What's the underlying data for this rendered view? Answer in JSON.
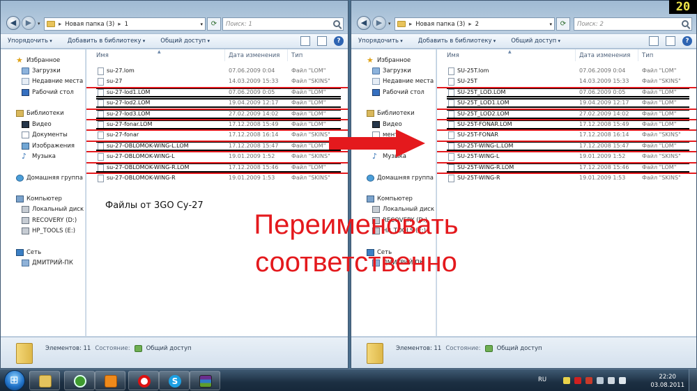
{
  "windows": [
    {
      "id": "left",
      "breadcrumb": [
        "Новая папка (3)",
        "1"
      ],
      "search_placeholder": "Поиск: 1",
      "toolbar": {
        "organize": "Упорядочить",
        "add_library": "Добавить в библиотеку",
        "share": "Общий доступ"
      },
      "columns": {
        "name": "Имя",
        "date": "Дата изменения",
        "type": "Тип"
      },
      "files": [
        {
          "name": "su-27.lom",
          "date": "07.06.2009 0:04",
          "type": "Файл \"LOM\""
        },
        {
          "name": "su-27",
          "date": "14.03.2009 15:33",
          "type": "Файл \"SKINS\""
        },
        {
          "name": "su-27-lod1.LOM",
          "date": "07.06.2009 0:05",
          "type": "Файл \"LOM\""
        },
        {
          "name": "su-27-lod2.LOM",
          "date": "19.04.2009 12:17",
          "type": "Файл \"LOM\""
        },
        {
          "name": "su-27-lod3.LOM",
          "date": "27.02.2009 14:02",
          "type": "Файл \"LOM\""
        },
        {
          "name": "su-27-fonar.LOM",
          "date": "17.12.2008 15:49",
          "type": "Файл \"LOM\""
        },
        {
          "name": "su-27-fonar",
          "date": "17.12.2008 16:14",
          "type": "Файл \"SKINS\""
        },
        {
          "name": "su-27-OBLOMOK-WING-L.LOM",
          "date": "17.12.2008 15:47",
          "type": "Файл \"LOM\""
        },
        {
          "name": "su-27-OBLOMOK-WING-L",
          "date": "19.01.2009 1:52",
          "type": "Файл \"SKINS\""
        },
        {
          "name": "su-27-OBLOMOK-WING-R.LOM",
          "date": "17.12.2008 15:46",
          "type": "Файл \"LOM\""
        },
        {
          "name": "su-27-OBLOMOK-WING-R",
          "date": "19.01.2009 1:53",
          "type": "Файл \"SKINS\""
        }
      ],
      "nav": {
        "favorites": "Избранное",
        "downloads": "Загрузки",
        "recent": "Недавние места",
        "desktop": "Рабочий стол",
        "libraries": "Библиотеки",
        "videos": "Видео",
        "documents": "Документы",
        "pictures": "Изображения",
        "music": "Музыка",
        "homegroup": "Домашняя группа",
        "computer": "Компьютер",
        "local_disk": "Локальный диск (C",
        "recovery": "RECOVERY (D:)",
        "hp_tools": "HP_TOOLS (E:)",
        "network": "Сеть",
        "network_pc": "ДМИТРИЙ-ПК"
      },
      "caption": "Файлы от 3GO Су-27",
      "details": {
        "items_label": "Элементов: 11",
        "state_label": "Состояние:",
        "state_value": "Общий доступ"
      }
    },
    {
      "id": "right",
      "breadcrumb": [
        "Новая папка (3)",
        "2"
      ],
      "search_placeholder": "Поиск: 2",
      "toolbar": {
        "organize": "Упорядочить",
        "add_library": "Добавить в библиотеку",
        "share": "Общий доступ"
      },
      "columns": {
        "name": "Имя",
        "date": "Дата изменения",
        "type": "Тип"
      },
      "files": [
        {
          "name": "SU-25T.lom",
          "date": "07.06.2009 0:04",
          "type": "Файл \"LOM\""
        },
        {
          "name": "SU-25T",
          "date": "14.03.2009 15:33",
          "type": "Файл \"SKINS\""
        },
        {
          "name": "SU-25T_LOD.LOM",
          "date": "07.06.2009 0:05",
          "type": "Файл \"LOM\""
        },
        {
          "name": "SU-25T_LOD1.LOM",
          "date": "19.04.2009 12:17",
          "type": "Файл \"LOM\""
        },
        {
          "name": "SU-25T_LOD2.LOM",
          "date": "27.02.2009 14:02",
          "type": "Файл \"LOM\""
        },
        {
          "name": "SU-25T-FONAR.LOM",
          "date": "17.12.2008 15:49",
          "type": "Файл \"LOM\""
        },
        {
          "name": "SU-25T-FONAR",
          "date": "17.12.2008 16:14",
          "type": "Файл \"SKINS\""
        },
        {
          "name": "SU-25T-WING-L.LOM",
          "date": "17.12.2008 15:47",
          "type": "Файл \"LOM\""
        },
        {
          "name": "SU-25T-WING-L",
          "date": "19.01.2009 1:52",
          "type": "Файл \"SKINS\""
        },
        {
          "name": "SU-25T-WING-R.LOM",
          "date": "17.12.2008 15:46",
          "type": "Файл \"LOM\""
        },
        {
          "name": "SU-25T-WING-R",
          "date": "19.01.2009 1:53",
          "type": "Файл \"SKINS\""
        }
      ],
      "nav": {
        "favorites": "Избранное",
        "downloads": "Загрузки",
        "recent": "Недавние места",
        "desktop": "Рабочий стол",
        "libraries": "Библиотеки",
        "videos": "Видео",
        "documents": "менты",
        "pictures": "",
        "music": "Музыка",
        "homegroup": "Домашняя группа",
        "computer": "Компьютер",
        "local_disk": "Локальный диск (C",
        "recovery": "RECOVERY (D:)",
        "hp_tools": "HP_TOOLS (E:)",
        "network": "Сеть",
        "network_pc": "ДМИТРИЙ-ПК"
      },
      "caption": "",
      "details": {
        "items_label": "Элементов: 11",
        "state_label": "Состояние:",
        "state_value": "Общий доступ"
      }
    }
  ],
  "overlay": {
    "line1": "Переименовать",
    "line2": "соответственно",
    "corner_number": "20",
    "accent_color": "#e4191d"
  },
  "taskbar": {
    "buttons": [
      "explorer",
      "utorrent",
      "media-player",
      "opera",
      "skype",
      "winrar"
    ],
    "tray": {
      "lang": "RU",
      "time": "22:20",
      "date": "03.08.2011"
    }
  }
}
